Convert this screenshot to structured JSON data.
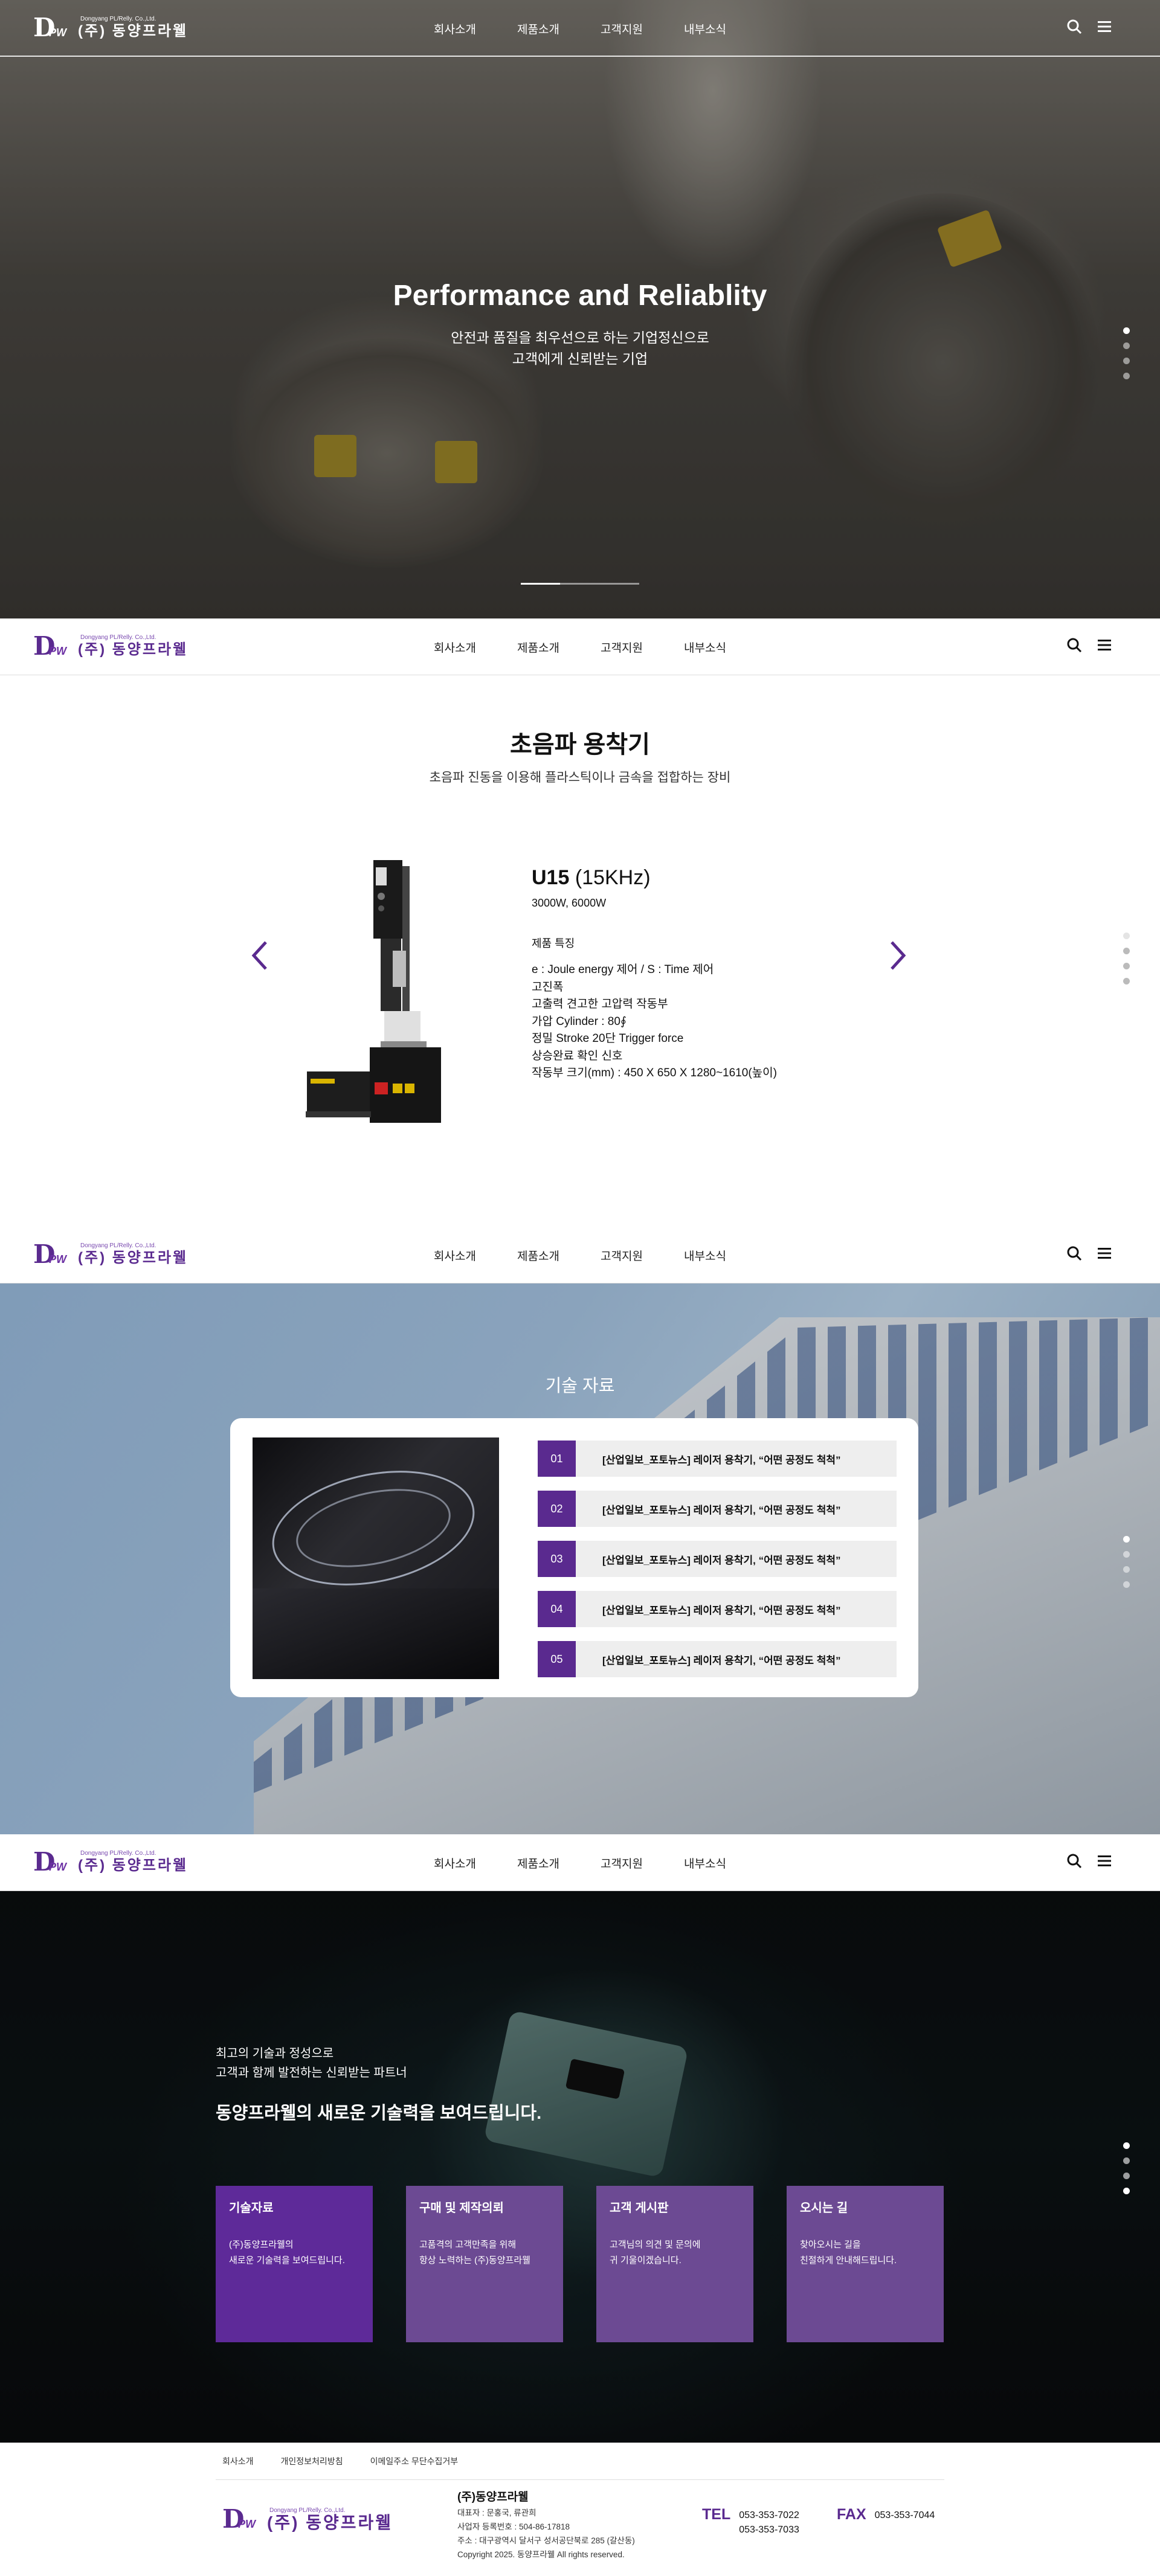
{
  "header": {
    "logo_en": "Dongyang PL/Relly. Co.,Ltd.",
    "logo_ko": "(주) 동양프라웰",
    "logo_mark": "D",
    "logo_pw": "PW",
    "nav": [
      "회사소개",
      "제품소개",
      "고객지원",
      "내부소식"
    ],
    "icons": [
      "search-icon",
      "menu-icon"
    ]
  },
  "hero": {
    "title": "Performance and Reliablity",
    "sub1": "안전과 품질을 최우선으로 하는 기업정신으로",
    "sub2": "고객에게 신뢰받는 기업",
    "slide_progress": 0.33
  },
  "product": {
    "title": "초음파 용착기",
    "subtitle": "초음파 진동을 이용해 플라스틱이나 금속을 접합하는 장비",
    "name": "U15",
    "freq": "(15KHz)",
    "power": "3000W, 6000W",
    "feature_heading": "제품 특징",
    "features": [
      "e : Joule energy 제어 / S : Time 제어",
      "고진폭",
      "고출력 견고한 고압력 작동부",
      "가압 Cylinder : 80∮",
      "정밀 Stroke 20단 Trigger force",
      "상승완료 확인 신호",
      "작동부 크기(mm) : 450 X 650 X 1280~1610(높이)"
    ]
  },
  "tech": {
    "title": "기술 자료",
    "items": [
      {
        "num": "01",
        "text": "[산업일보_포토뉴스] 레이저 용착기, “어떤 공정도 척척”"
      },
      {
        "num": "02",
        "text": "[산업일보_포토뉴스] 레이저 용착기, “어떤 공정도 척척”"
      },
      {
        "num": "03",
        "text": "[산업일보_포토뉴스] 레이저 용착기, “어떤 공정도 척척”"
      },
      {
        "num": "04",
        "text": "[산업일보_포토뉴스] 레이저 용착기, “어떤 공정도 척척”"
      },
      {
        "num": "05",
        "text": "[산업일보_포토뉴스] 레이저 용착기, “어떤 공정도 척척”"
      }
    ]
  },
  "company": {
    "line1": "최고의 기술과 정성으로",
    "line2": "고객과 함께 발전하는 신뢰받는 파트너",
    "headline": "동양프라웰의 새로운 기술력을 보여드립니다.",
    "cards": [
      {
        "title": "기술자료",
        "d1": "(주)동양프라웰의",
        "d2": "새로운 기술력을 보여드립니다.",
        "color": "#5e2a99"
      },
      {
        "title": "구매 및 제작의뢰",
        "d1": "고품격의 고객만족을 위해",
        "d2": "항상 노력하는 (주)동양프라웰",
        "color": "#6c4a93"
      },
      {
        "title": "고객 게시판",
        "d1": "고객님의 의견 및 문의에",
        "d2": "귀 기울이겠습니다.",
        "color": "#6c4a93"
      },
      {
        "title": "오시는 길",
        "d1": "찾아오시는 길을",
        "d2": "친절하게 안내해드립니다.",
        "color": "#6c4a93"
      }
    ]
  },
  "footer": {
    "links": [
      "회사소개",
      "개인정보처리방침",
      "이메일주소 무단수집거부"
    ],
    "company": "(주)동양프라웰",
    "ceo": "대표자 : 문홍국, 류관희",
    "bizno": "사업자 등록번호 : 504-86-17818",
    "address": "주소 : 대구광역시 달서구 성서공단북로 285 (갈산동)",
    "copyright": "Copyright 2025. 동양프라웰 All rights reserved.",
    "tel_label": "TEL",
    "tel1": "053-353-7022",
    "tel2": "053-353-7033",
    "fax_label": "FAX",
    "fax": "053-353-7044"
  },
  "colors": {
    "accent": "#5a2a8f",
    "card": "#6c4a93"
  }
}
